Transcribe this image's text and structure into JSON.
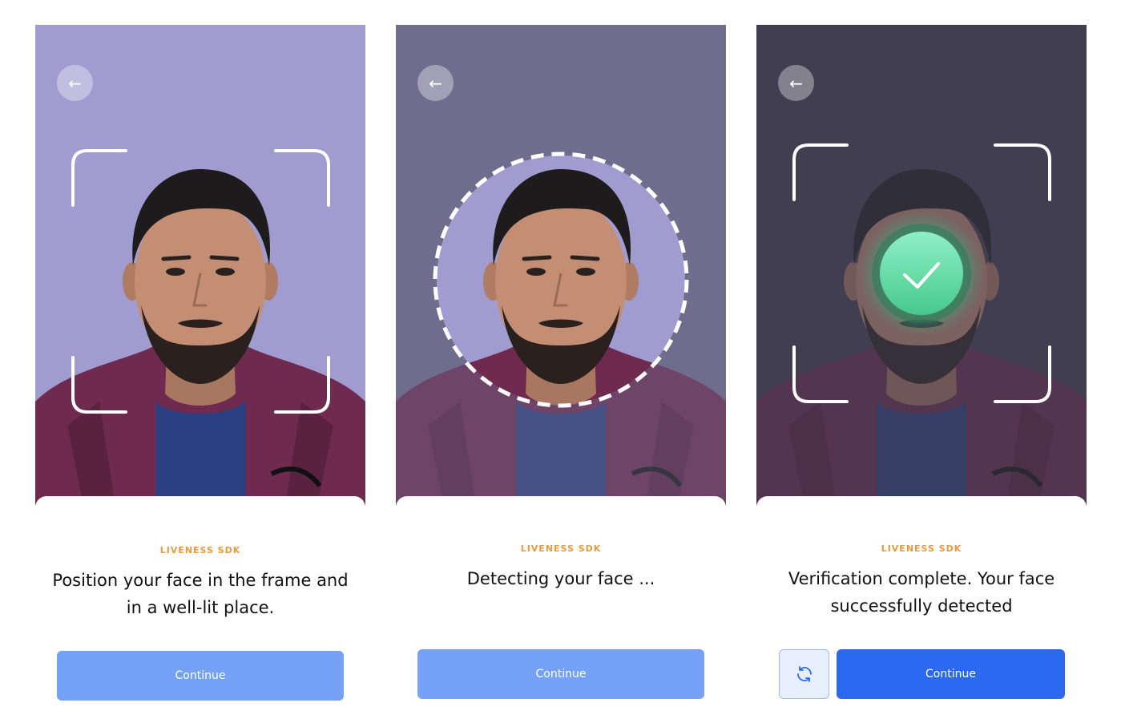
{
  "screens": [
    {
      "eyebrow": "LIVENESS SDK",
      "message": "Position your face in the frame and in a well-lit place.",
      "continue_label": "Continue",
      "background": "#a19ccf"
    },
    {
      "eyebrow": "LIVENESS SDK",
      "message": "Detecting your face ...",
      "continue_label": "Continue",
      "background": "#6f6d8e"
    },
    {
      "eyebrow": "LIVENESS SDK",
      "message": "Verification complete. Your face successfully detected",
      "continue_label": "Continue",
      "background": "#403e50"
    }
  ],
  "icons": {
    "back": "arrow-left-icon",
    "retry": "refresh-icon",
    "success": "checkmark-icon"
  },
  "colors": {
    "accent_orange": "#e89a3c",
    "button_disabled": "#75a1f7",
    "button_primary": "#2b69f0",
    "success_green": "#5fe0a8"
  }
}
